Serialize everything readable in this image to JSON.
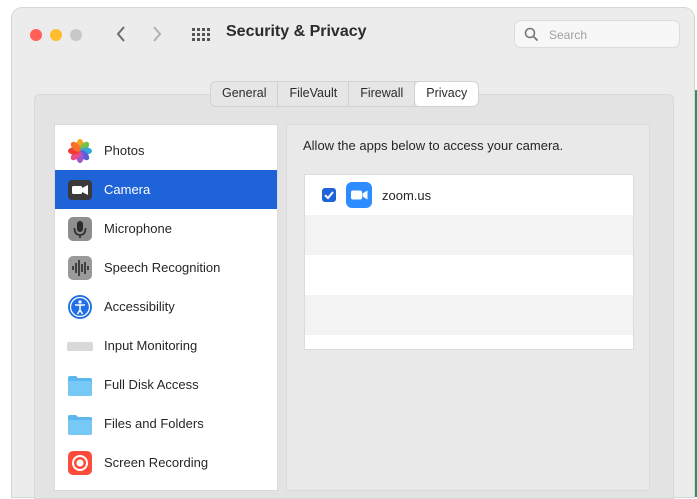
{
  "window": {
    "title": "Security & Privacy"
  },
  "search": {
    "placeholder": "Search"
  },
  "tabs": [
    {
      "label": "General",
      "active": false
    },
    {
      "label": "FileVault",
      "active": false
    },
    {
      "label": "Firewall",
      "active": false
    },
    {
      "label": "Privacy",
      "active": true
    }
  ],
  "sidebar": {
    "items": [
      {
        "label": "Photos",
        "icon": "photos-icon",
        "selected": false
      },
      {
        "label": "Camera",
        "icon": "camera-icon",
        "selected": true
      },
      {
        "label": "Microphone",
        "icon": "microphone-icon",
        "selected": false
      },
      {
        "label": "Speech Recognition",
        "icon": "speech-recognition-icon",
        "selected": false
      },
      {
        "label": "Accessibility",
        "icon": "accessibility-icon",
        "selected": false
      },
      {
        "label": "Input Monitoring",
        "icon": "keyboard-icon",
        "selected": false
      },
      {
        "label": "Full Disk Access",
        "icon": "folder-icon",
        "selected": false
      },
      {
        "label": "Files and Folders",
        "icon": "folder-icon",
        "selected": false
      },
      {
        "label": "Screen Recording",
        "icon": "screen-recording-icon",
        "selected": false
      }
    ]
  },
  "content": {
    "description": "Allow the apps below to access your camera.",
    "apps": [
      {
        "name": "zoom.us",
        "icon": "zoom-icon",
        "checked": true
      }
    ]
  },
  "colors": {
    "accent": "#1f63d8",
    "traffic_close": "#ff5f57",
    "traffic_minimize": "#febc2e",
    "traffic_zoom": "#c8c8c8"
  }
}
